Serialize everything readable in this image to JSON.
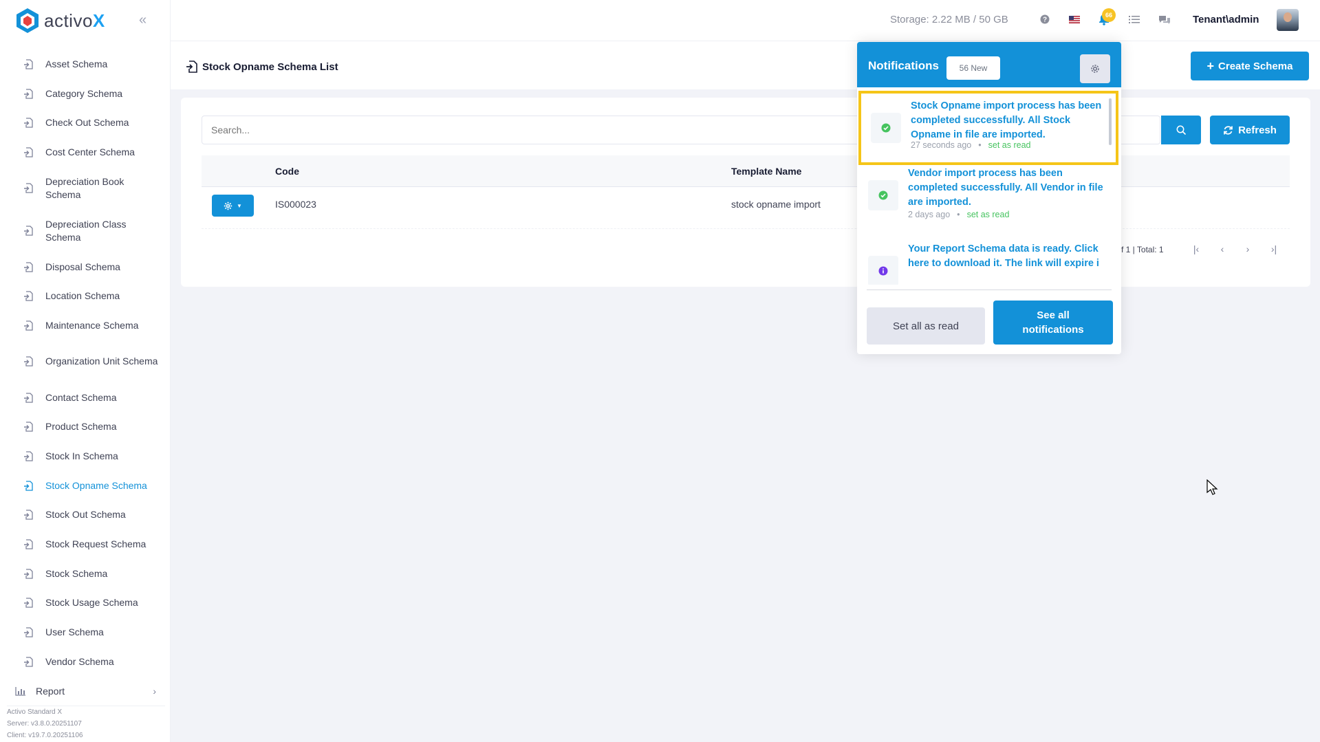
{
  "app": {
    "brand_main": "activo",
    "brand_accent": "X",
    "accent_color": "#1391d8"
  },
  "sidebar": {
    "items": [
      {
        "label": "Asset Schema",
        "active": false
      },
      {
        "label": "Category Schema",
        "active": false
      },
      {
        "label": "Check Out Schema",
        "active": false
      },
      {
        "label": "Cost Center Schema",
        "active": false
      },
      {
        "label": "Depreciation Book Schema",
        "active": false
      },
      {
        "label": "Depreciation Class Schema",
        "active": false
      },
      {
        "label": "Disposal Schema",
        "active": false
      },
      {
        "label": "Location Schema",
        "active": false
      },
      {
        "label": "Maintenance Schema",
        "active": false
      },
      {
        "label": "Organization Unit Schema",
        "active": false
      },
      {
        "label": "Contact Schema",
        "active": false
      },
      {
        "label": "Product Schema",
        "active": false
      },
      {
        "label": "Stock In Schema",
        "active": false
      },
      {
        "label": "Stock Opname Schema",
        "active": true
      },
      {
        "label": "Stock Out Schema",
        "active": false
      },
      {
        "label": "Stock Request Schema",
        "active": false
      },
      {
        "label": "Stock Schema",
        "active": false
      },
      {
        "label": "Stock Usage Schema",
        "active": false
      },
      {
        "label": "User Schema",
        "active": false
      },
      {
        "label": "Vendor Schema",
        "active": false
      }
    ],
    "report_label": "Report",
    "footer": {
      "product": "Activo Standard X",
      "server": "Server: v3.8.0.20251107",
      "client": "Client: v19.7.0.20251106"
    }
  },
  "header": {
    "storage": "Storage: 2.22 MB / 50 GB",
    "notification_count": "66",
    "user": "Tenant\\admin"
  },
  "page": {
    "title": "Stock Opname Schema List",
    "create_button": "Create Schema",
    "search_placeholder": "Search...",
    "refresh_button": "Refresh",
    "columns": {
      "code": "Code",
      "template_name": "Template Name"
    },
    "rows": [
      {
        "code": "IS000023",
        "template_name": "stock opname import"
      }
    ],
    "pager_text": "f 1 | Total: 1"
  },
  "notifications": {
    "title": "Notifications",
    "new_badge": "56 New",
    "items": [
      {
        "text": "Stock Opname import process has been completed successfully. All Stock Opname in file are imported.",
        "time": "27 seconds ago",
        "action": "set as read",
        "status": "success"
      },
      {
        "text": "Vendor import process has been completed successfully. All Vendor in file are imported.",
        "time": "2 days ago",
        "action": "set as read",
        "status": "success"
      },
      {
        "text": "Your Report Schema data is ready. Click here to download it. The link will expire i",
        "time": "",
        "action": "",
        "status": "info"
      }
    ],
    "set_all_read": "Set all as read",
    "see_all": "See all notifications"
  }
}
